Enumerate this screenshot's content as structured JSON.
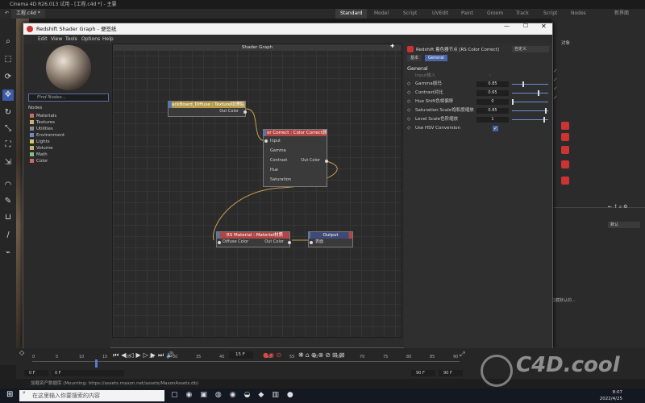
{
  "os_title": "Cinema 4D R26.013 试用 - [工程.c4d *] - 主要",
  "doc_tab": "工程.c4d *",
  "app_tabs": [
    "Standard",
    "Model",
    "Script",
    "UVEdit",
    "Paint",
    "Groom",
    "Track",
    "Script",
    "Nodes",
    "新界面"
  ],
  "app_tab_active": 0,
  "shader_graph": {
    "title": "Redshift Shader Graph - 便签纸",
    "menu": [
      "Edit",
      "View",
      "Tools",
      "Options",
      "Help"
    ],
    "graph_title": "Shader Graph",
    "library": {
      "find_placeholder": "Find Nodes...",
      "root": "Nodes",
      "items": [
        {
          "label": "Materials",
          "color": "#c96a6a"
        },
        {
          "label": "Textures",
          "color": "#c7b46a"
        },
        {
          "label": "Utilities",
          "color": "#8a8a8a"
        },
        {
          "label": "Environment",
          "color": "#6a8ac9"
        },
        {
          "label": "Lights",
          "color": "#d4c66a"
        },
        {
          "label": "Volume",
          "color": "#c7b46a"
        },
        {
          "label": "Math",
          "color": "#8bbf7a"
        },
        {
          "label": "Color",
          "color": "#c96a6a"
        }
      ]
    },
    "nodes": {
      "texture": {
        "title": "ackBoard_Diffuse : Texture纹理贴",
        "out": "Out Color"
      },
      "color_correct": {
        "title": "or Correct : Color Correct颜",
        "inputs": [
          "Input",
          "Gamma",
          "Contrast",
          "Hue",
          "Saturation"
        ],
        "out": "Out Color"
      },
      "rs_material": {
        "title": "RS Material : Material材质",
        "in": "Diffuse Color",
        "out": "Out Color"
      },
      "output": {
        "title": "Output",
        "in": "表面"
      }
    },
    "attributes": {
      "header": "Redshift 着色器节点 [RS Color Correct]",
      "preset": "自定义",
      "tabs": [
        "基本",
        "General"
      ],
      "active_tab": 1,
      "section": "General",
      "input_label": "Input输入",
      "rows": [
        {
          "label": "Gamma伽玛",
          "value": "0.85",
          "fill": 0.3
        },
        {
          "label": "Contrast对比",
          "value": "0.65",
          "fill": 0.75
        },
        {
          "label": "Hue Shift色相偏移",
          "value": "0",
          "fill": 0.0
        },
        {
          "label": "Saturation Scale饱和度缩放",
          "value": "0.85",
          "fill": 0.95
        },
        {
          "label": "Level Scale色阶缩放",
          "value": "1",
          "fill": 0.9
        }
      ],
      "hsv_label": "Use HSV Conversion",
      "hsv_checked": true
    }
  },
  "right_panel": {
    "title": "对象",
    "dropdown": "默认",
    "bottom_text": "隐藏默认的..."
  },
  "timeline": {
    "ticks": [
      "0",
      "5",
      "10",
      "15",
      "20",
      "25",
      "30",
      "35",
      "40",
      "45",
      "50",
      "55",
      "60",
      "65",
      "70",
      "75",
      "80",
      "85",
      "90"
    ],
    "current_frame": "15 F",
    "start_field": "0 F",
    "start_field2": "0 F",
    "end_field": "90 F",
    "end_field2": "90 F"
  },
  "status": "加载资产数据库 (Mounting: https://assets.maxon.net/assets/MaxonAssets.db)",
  "taskbar": {
    "search": "在这里输入你要搜索的内容",
    "clock_time": "8:07",
    "clock_date": "2022/4/25"
  },
  "watermark": "C4D.cool"
}
